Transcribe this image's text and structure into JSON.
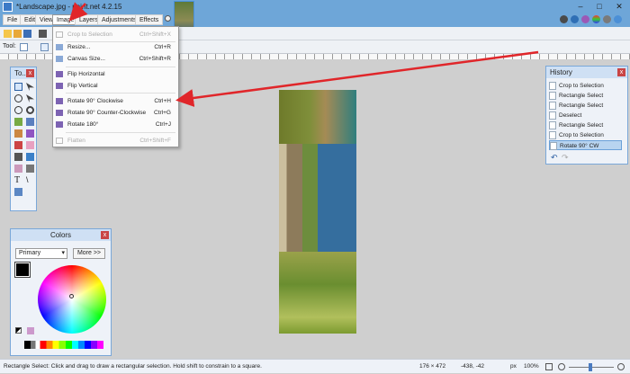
{
  "window": {
    "title": "*Landscape.jpg - paint.net 4.2.15",
    "controls": [
      "minimize-icon",
      "maximize-icon",
      "close-icon"
    ],
    "accent": "#6ea6d8"
  },
  "menubar": {
    "items": [
      "File",
      "Edit",
      "View",
      "Image",
      "Layers",
      "Adjustments",
      "Effects"
    ]
  },
  "toolbar": {
    "tool_label": "Tool:"
  },
  "image_menu": {
    "items": [
      {
        "label": "Crop to Selection",
        "shortcut": "Ctrl+Shift+X",
        "disabled": true,
        "icon": "crop-icon"
      },
      {
        "label": "Resize...",
        "shortcut": "Ctrl+R",
        "disabled": false,
        "icon": "resize-icon"
      },
      {
        "label": "Canvas Size...",
        "shortcut": "Ctrl+Shift+R",
        "disabled": false,
        "icon": "canvas-size-icon"
      },
      {
        "label": "Flip Horizontal",
        "shortcut": "",
        "disabled": false,
        "icon": "flip-horizontal-icon"
      },
      {
        "label": "Flip Vertical",
        "shortcut": "",
        "disabled": false,
        "icon": "flip-vertical-icon"
      },
      {
        "label": "Rotate 90° Clockwise",
        "shortcut": "Ctrl+H",
        "disabled": false,
        "highlighted": true,
        "icon": "rotate-cw-icon"
      },
      {
        "label": "Rotate 90° Counter-Clockwise",
        "shortcut": "Ctrl+G",
        "disabled": false,
        "icon": "rotate-ccw-icon"
      },
      {
        "label": "Rotate 180°",
        "shortcut": "Ctrl+J",
        "disabled": false,
        "icon": "rotate-180-icon"
      },
      {
        "label": "Flatten",
        "shortcut": "Ctrl+Shift+F",
        "disabled": true,
        "icon": "flatten-icon"
      }
    ]
  },
  "tools_panel": {
    "title": "To...",
    "close": "x"
  },
  "history": {
    "title": "History",
    "close": "x",
    "items": [
      {
        "label": "Crop to Selection"
      },
      {
        "label": "Rectangle Select"
      },
      {
        "label": "Rectangle Select"
      },
      {
        "label": "Deselect"
      },
      {
        "label": "Rectangle Select"
      },
      {
        "label": "Crop to Selection"
      },
      {
        "label": "Rotate 90° CW",
        "selected": true
      }
    ]
  },
  "colors": {
    "title": "Colors",
    "close": "x",
    "mode": "Primary",
    "more_button": "More >>"
  },
  "statusbar": {
    "hint": "Rectangle Select: Click and drag to draw a rectangular selection. Hold shift to constrain to a square.",
    "size": "176 × 472",
    "coords": "-438, -42",
    "units": "px",
    "zoom": "100%"
  },
  "annotation": {
    "arrow_color": "#e0262a"
  }
}
